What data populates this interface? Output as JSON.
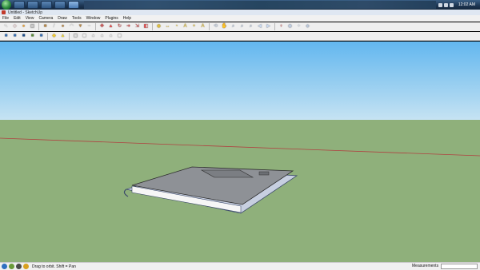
{
  "window": {
    "title": "Untitled - SketchUp"
  },
  "menu": [
    "File",
    "Edit",
    "View",
    "Camera",
    "Draw",
    "Tools",
    "Window",
    "Plugins",
    "Help"
  ],
  "taskbar": {
    "clock": "12:02 AM"
  },
  "toolbar_row1": [
    {
      "icon": "select-icon",
      "glyph": "↖",
      "color": "#ffffff"
    },
    {
      "icon": "eraser-icon",
      "glyph": "◇",
      "color": "#f4c6c6"
    },
    {
      "icon": "paint-bucket-icon",
      "glyph": "●",
      "color": "#e8a33d"
    },
    {
      "icon": "make-component-icon",
      "glyph": "▣",
      "color": "#c9c9c9"
    },
    {
      "icon": "rectangle-icon",
      "glyph": "■",
      "color": "#b8894a"
    },
    {
      "icon": "line-icon",
      "glyph": "/",
      "color": "#f2f2f2"
    },
    {
      "icon": "circle-icon",
      "glyph": "●",
      "color": "#b8894a"
    },
    {
      "icon": "arc-icon",
      "glyph": "◠",
      "color": "#f2f2f2"
    },
    {
      "icon": "polygon-icon",
      "glyph": "▼",
      "color": "#b8894a"
    },
    {
      "icon": "freehand-icon",
      "glyph": "~",
      "color": "#f2f2f2"
    },
    {
      "icon": "move-icon",
      "glyph": "✥",
      "color": "#e05050"
    },
    {
      "icon": "push-pull-icon",
      "glyph": "▲",
      "color": "#e05050"
    },
    {
      "icon": "rotate-icon",
      "glyph": "↻",
      "color": "#e05050"
    },
    {
      "icon": "follow-me-icon",
      "glyph": "➜",
      "color": "#e05050"
    },
    {
      "icon": "scale-icon",
      "glyph": "⇲",
      "color": "#e05050"
    },
    {
      "icon": "offset-icon",
      "glyph": "◧",
      "color": "#e05050"
    },
    {
      "icon": "tape-measure-icon",
      "glyph": "◉",
      "color": "#f0c830"
    },
    {
      "icon": "dimension-icon",
      "glyph": "↔",
      "color": "#f0c830"
    },
    {
      "icon": "protractor-icon",
      "glyph": "◔",
      "color": "#f0c830"
    },
    {
      "icon": "text-icon",
      "glyph": "A",
      "color": "#f0c830"
    },
    {
      "icon": "axes-icon",
      "glyph": "+",
      "color": "#f0c830"
    },
    {
      "icon": "3d-text-icon",
      "glyph": "A",
      "color": "#f0c830"
    },
    {
      "icon": "orbit-icon",
      "glyph": "⟲",
      "color": "#c8d8f0"
    },
    {
      "icon": "pan-icon",
      "glyph": "✋",
      "color": "#c8d8f0"
    },
    {
      "icon": "zoom-icon",
      "glyph": "⌕",
      "color": "#c8d8f0"
    },
    {
      "icon": "zoom-window-icon",
      "glyph": "⌕",
      "color": "#c8d8f0"
    },
    {
      "icon": "zoom-extents-icon",
      "glyph": "⌕",
      "color": "#c8d8f0"
    },
    {
      "icon": "previous-view-icon",
      "glyph": "◀",
      "color": "#c8d8f0"
    },
    {
      "icon": "next-view-icon",
      "glyph": "▶",
      "color": "#c8d8f0"
    },
    {
      "icon": "position-camera-icon",
      "glyph": "♀",
      "color": "#e05050"
    },
    {
      "icon": "look-around-icon",
      "glyph": "◉",
      "color": "#c8d8f0"
    },
    {
      "icon": "walk-icon",
      "glyph": "⁘",
      "color": "#c8d8f0"
    },
    {
      "icon": "section-plane-icon",
      "glyph": "◈",
      "color": "#c8d8f0"
    }
  ],
  "toolbar_row2": [
    {
      "icon": "xray-icon",
      "glyph": "■",
      "color": "#3a6fb0"
    },
    {
      "icon": "wireframe-icon",
      "glyph": "■",
      "color": "#3a6fb0"
    },
    {
      "icon": "hidden-line-icon",
      "glyph": "■",
      "color": "#1e4e8a"
    },
    {
      "icon": "shaded-icon",
      "glyph": "■",
      "color": "#5a8a3a"
    },
    {
      "icon": "shaded-textures-icon",
      "glyph": "■",
      "color": "#3a6fb0"
    },
    {
      "icon": "shadows-icon",
      "glyph": "◆",
      "color": "#f0c830"
    },
    {
      "icon": "fog-icon",
      "glyph": "▲",
      "color": "#e8d040"
    },
    {
      "icon": "iso-view-icon",
      "glyph": "▣",
      "color": "#dcdcdc"
    },
    {
      "icon": "top-view-icon",
      "glyph": "▢",
      "color": "#dcdcdc"
    },
    {
      "icon": "front-view-icon",
      "glyph": "⌂",
      "color": "#dcdcdc"
    },
    {
      "icon": "right-view-icon",
      "glyph": "⌂",
      "color": "#dcdcdc"
    },
    {
      "icon": "back-view-icon",
      "glyph": "⌂",
      "color": "#dcdcdc"
    },
    {
      "icon": "left-view-icon",
      "glyph": "▢",
      "color": "#dcdcdc"
    }
  ],
  "statusbar": {
    "hint": "Drag to orbit.  Shift = Pan",
    "measurements_label": "Measurements",
    "measurements_value": ""
  },
  "scene": {
    "sky_color": "#62b7ef",
    "ground_color": "#8fb07b",
    "axis_color": "#b04040"
  }
}
